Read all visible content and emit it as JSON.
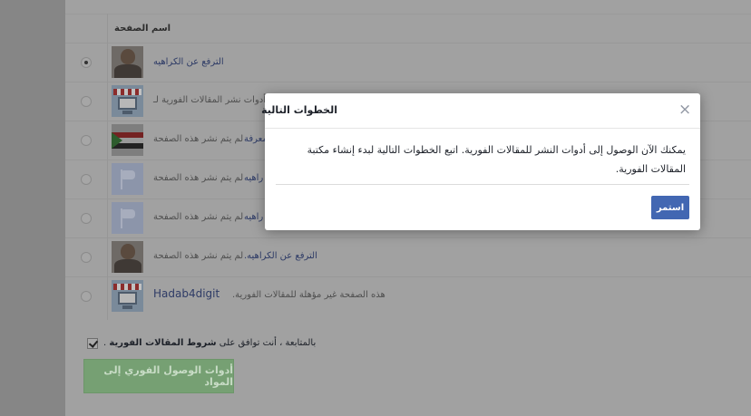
{
  "table": {
    "header": "اسم الصفحة",
    "rows": [
      {
        "selected": true,
        "thumb": "portrait",
        "name": "الترفع عن الكراهيه",
        "status": ""
      },
      {
        "selected": false,
        "thumb": "shop",
        "name": "",
        "status": "لم يتم نشر أدوات نشر المقالات الفورية لـ"
      },
      {
        "selected": false,
        "thumb": "sudan-flag",
        "name": "معرفة",
        "status": "لم يتم نشر هذه الصفحة"
      },
      {
        "selected": false,
        "thumb": "flag-placeholder",
        "name": "راهيه",
        "status": "لم يتم نشر هذه الصفحة"
      },
      {
        "selected": false,
        "thumb": "flag-placeholder",
        "name": "راهيه",
        "status": "لم يتم نشر هذه الصفحة"
      },
      {
        "selected": false,
        "thumb": "portrait",
        "name": "الترفع عن الكراهيه.",
        "status": "لم يتم نشر هذه الصفحة"
      },
      {
        "selected": false,
        "thumb": "shop",
        "name": "Hadab4digit",
        "status": "هذه الصفحة غير مؤهلة للمقالات الفورية."
      }
    ]
  },
  "footer": {
    "agree_prefix": "بالمتابعة ، أنت توافق على",
    "agree_link": "شروط المقالات الفورية",
    "agree_suffix": ".",
    "button_label": "أدوات الوصول الفوري إلى المواد"
  },
  "modal": {
    "title": "الخطوات التالية",
    "close_glyph": "×",
    "body": "يمكنك الآن الوصول إلى أدوات النشر للمقالات الفورية. اتبع الخطوات التالية لبدء إنشاء مكتبة المقالات الفورية.",
    "continue_label": "استمر"
  }
}
